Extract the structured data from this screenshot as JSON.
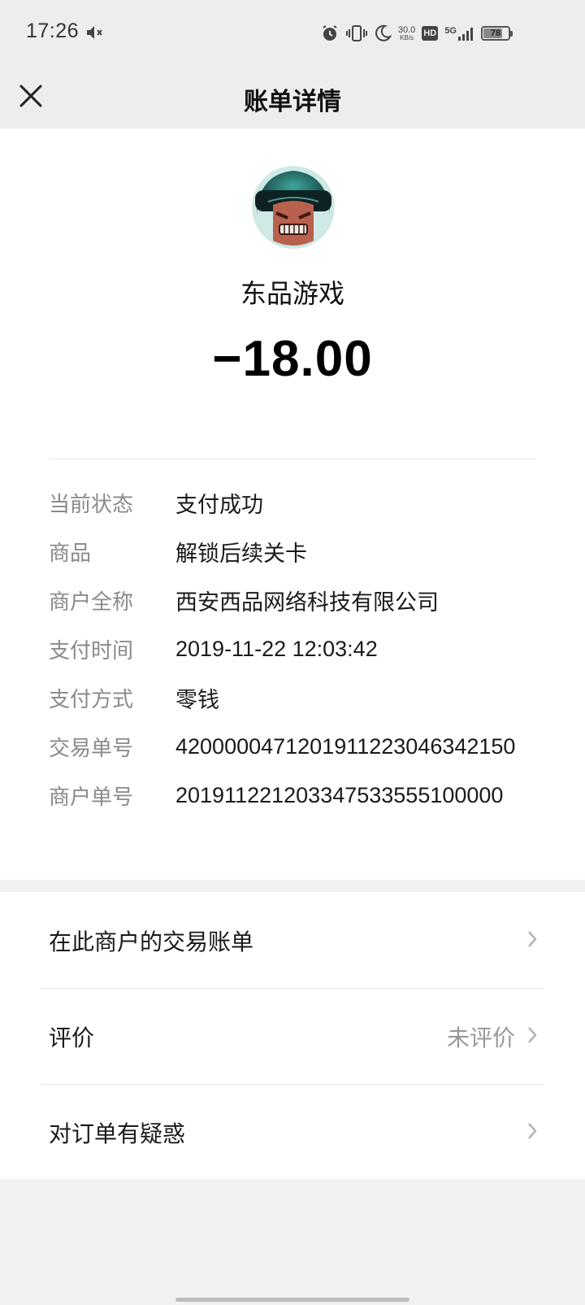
{
  "status_bar": {
    "time": "17:26",
    "net_speed_value": "30.0",
    "net_speed_unit": "KB/s",
    "hd": "HD",
    "network": "5G",
    "battery": "78",
    "battery_level_percent": 78,
    "icons": [
      "mute-icon",
      "alarm-icon",
      "vibrate-icon",
      "moon-icon",
      "signal-icon"
    ]
  },
  "nav": {
    "title": "账单详情",
    "close_icon": "close-icon"
  },
  "merchant": {
    "name": "东品游戏",
    "amount": "−18.00"
  },
  "details": [
    {
      "label": "当前状态",
      "value": "支付成功"
    },
    {
      "label": "商品",
      "value": "解锁后续关卡"
    },
    {
      "label": "商户全称",
      "value": "西安西品网络科技有限公司"
    },
    {
      "label": "支付时间",
      "value": "2019-11-22 12:03:42"
    },
    {
      "label": "支付方式",
      "value": "零钱"
    },
    {
      "label": "交易单号",
      "value": "4200000471201911223046342150"
    },
    {
      "label": "商户单号",
      "value": "201911221203347533555100000"
    }
  ],
  "actions": [
    {
      "label": "在此商户的交易账单",
      "value": ""
    },
    {
      "label": "评价",
      "value": "未评价"
    },
    {
      "label": "对订单有疑惑",
      "value": ""
    }
  ],
  "colors": {
    "background": "#f2f2f2",
    "card": "#ffffff",
    "label_gray": "#8a8a8a",
    "text": "#1a1a1a"
  }
}
